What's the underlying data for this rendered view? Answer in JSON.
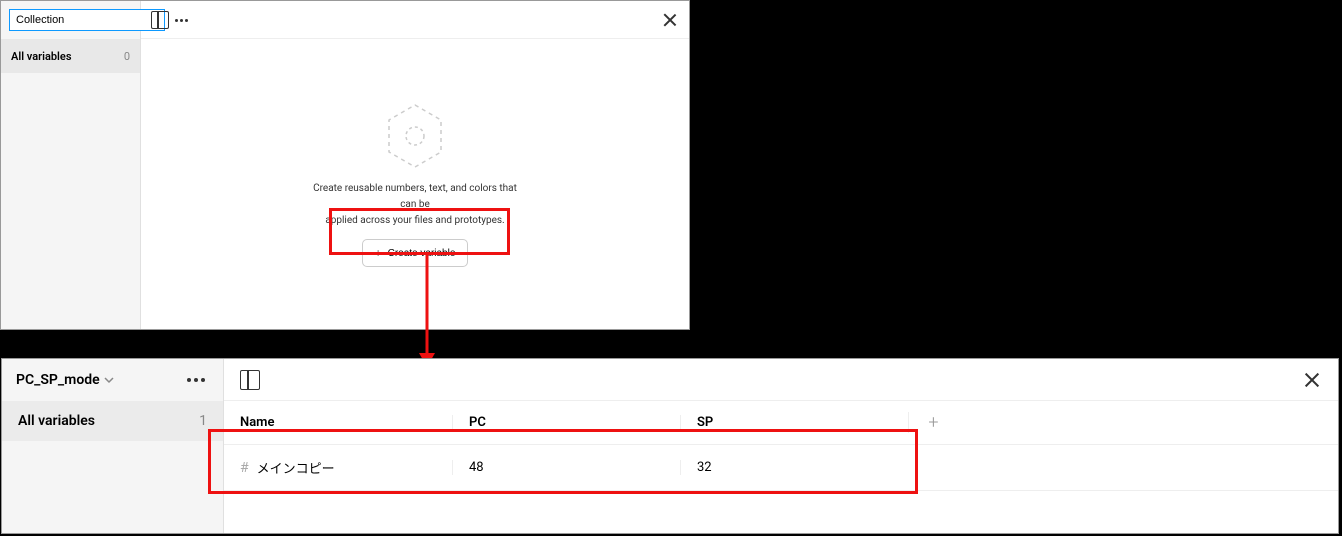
{
  "panel1": {
    "collection_input": "Collection",
    "sidebar": {
      "all_variables_label": "All variables",
      "count": "0"
    },
    "empty": {
      "line1": "Create reusable numbers, text, and colors that can be",
      "line2": "applied across your files and prototypes.",
      "button": "Create variable"
    }
  },
  "panel2": {
    "collection_name": "PC_SP_mode",
    "sidebar": {
      "all_variables_label": "All variables",
      "count": "1"
    },
    "headers": {
      "name": "Name",
      "mode1": "PC",
      "mode2": "SP"
    },
    "rows": [
      {
        "name": "メインコピー",
        "pc": "48",
        "sp": "32"
      }
    ]
  },
  "colors": {
    "highlight": "#e11",
    "accent": "#0d99ff"
  }
}
